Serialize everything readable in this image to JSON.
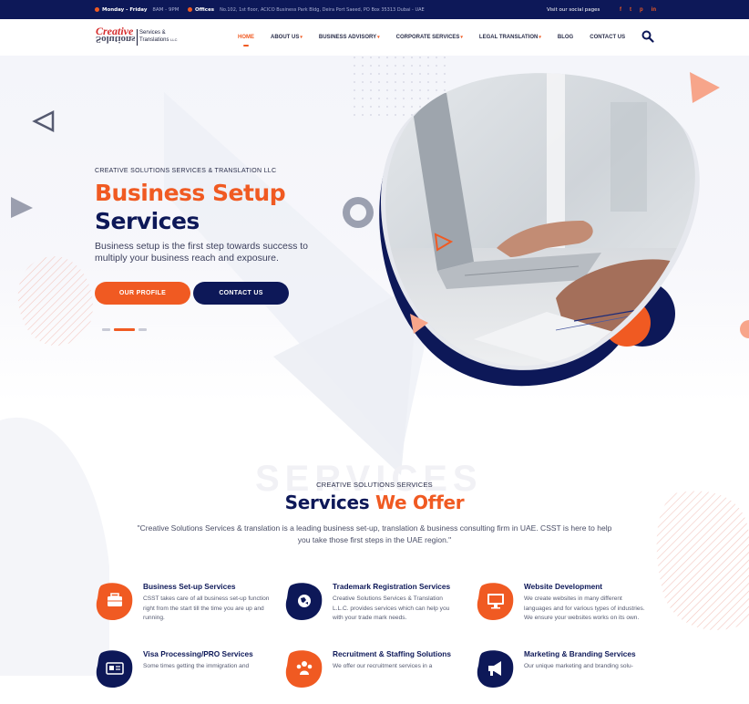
{
  "topbar": {
    "hours_label": "Monday - Friday",
    "hours_value": "8AM - 9PM",
    "office_label": "Offices",
    "office_value": "No.102, 1st floor, ACICO Business Park Bldg, Deira Port Saeed, PO Box 35313 Dubai - UAE",
    "social_label": "Visit our social pages",
    "social_icons": [
      "facebook-icon",
      "twitter-icon",
      "pinterest-icon",
      "linkedin-icon"
    ],
    "social_glyphs": [
      "f",
      "t",
      "p",
      "in"
    ]
  },
  "logo": {
    "word1": "Creative",
    "word2": "Solutions",
    "line1": "Services &",
    "line2": "Translations",
    "suffix": "LLC"
  },
  "nav": {
    "items": [
      {
        "label": "HOME",
        "active": true,
        "dropdown": false
      },
      {
        "label": "ABOUT US",
        "active": false,
        "dropdown": true
      },
      {
        "label": "BUSINESS ADVISORY",
        "active": false,
        "dropdown": true
      },
      {
        "label": "CORPORATE SERVICES",
        "active": false,
        "dropdown": true
      },
      {
        "label": "LEGAL TRANSLATION",
        "active": false,
        "dropdown": true
      },
      {
        "label": "BLOG",
        "active": false,
        "dropdown": false
      },
      {
        "label": "CONTACT US",
        "active": false,
        "dropdown": false
      }
    ],
    "search_icon": "search-icon"
  },
  "hero": {
    "eyebrow": "CREATIVE SOLUTIONS SERVICES & TRANSLATION LLC",
    "title_line1": "Business Setup",
    "title_line2": "Services",
    "lead": "Business setup is the first step towards success to multiply your business reach and exposure.",
    "btn_primary": "OUR PROFILE",
    "btn_secondary": "CONTACT US",
    "slides": 3,
    "active_slide": 2
  },
  "services": {
    "ghost": "SERVICES",
    "eyebrow": "CREATIVE SOLUTIONS SERVICES",
    "title_part1": "Services",
    "title_part2": "We Offer",
    "description": "\"Creative Solutions Services & translation is a leading business set-up, translation & business consulting firm in UAE. CSST is here to help you take those first steps in the UAE region.\"",
    "cards": [
      {
        "title": "Business Set-up Services",
        "desc": "CSST takes care of all business set-up function right from the start till the time you are up and running.",
        "icon": "briefcase-icon",
        "color": "#f05a22"
      },
      {
        "title": "Trademark Registration Services",
        "desc": "Creative Solutions Services & Translation L.L.C. provides services which can help you with your trade mark needs.",
        "icon": "globe-icon",
        "color": "#0d1858"
      },
      {
        "title": "Website Development",
        "desc": "We create websites in many different languages and for various types of industries. We ensure your websites works on its own.",
        "icon": "monitor-icon",
        "color": "#f05a22"
      },
      {
        "title": "Visa Processing/PRO Services",
        "desc": "Some times getting the immigration and",
        "icon": "id-card-icon",
        "color": "#0d1858"
      },
      {
        "title": "Recruitment & Staffing Solutions",
        "desc": "We offer our recruitment services in a",
        "icon": "people-icon",
        "color": "#f05a22"
      },
      {
        "title": "Marketing & Branding Services",
        "desc": "Our unique marketing and branding solu-",
        "icon": "megaphone-icon",
        "color": "#0d1858"
      }
    ]
  },
  "colors": {
    "accent": "#f05a22",
    "navy": "#0d1858"
  }
}
